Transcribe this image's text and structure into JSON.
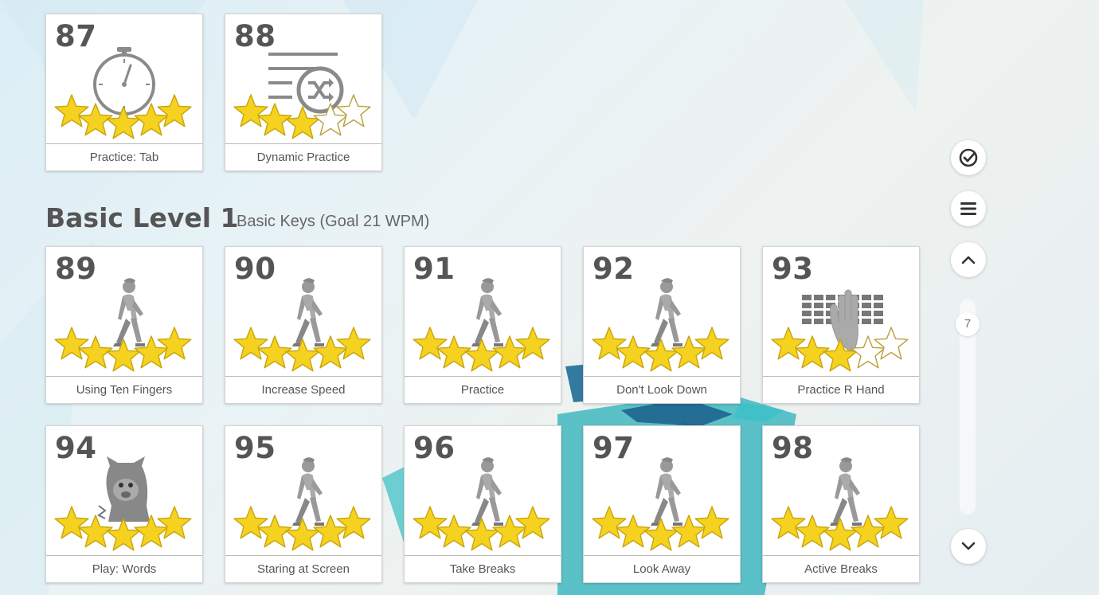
{
  "sections": [
    {
      "tiles": [
        {
          "number": "87",
          "label": "Practice: Tab",
          "icon": "stopwatch-icon",
          "stars": 5
        },
        {
          "number": "88",
          "label": "Dynamic Practice",
          "icon": "shuffle-list-icon",
          "stars": 3
        }
      ]
    },
    {
      "title": "Basic Level 1",
      "subtitle": "Basic Keys (Goal 21 WPM)",
      "tiles": [
        {
          "number": "89",
          "label": "Using Ten Fingers",
          "icon": "walking-person-icon",
          "stars": 5
        },
        {
          "number": "90",
          "label": "Increase Speed",
          "icon": "walking-person-icon",
          "stars": 5
        },
        {
          "number": "91",
          "label": "Practice",
          "icon": "walking-person-icon",
          "stars": 5
        },
        {
          "number": "92",
          "label": "Don't Look Down",
          "icon": "walking-person-icon",
          "stars": 5
        },
        {
          "number": "93",
          "label": "Practice R Hand",
          "icon": "keyboard-hand-icon",
          "stars": 3
        },
        {
          "number": "94",
          "label": "Play: Words",
          "icon": "monster-icon",
          "stars": 5
        },
        {
          "number": "95",
          "label": "Staring at Screen",
          "icon": "walking-person-icon",
          "stars": 5
        },
        {
          "number": "96",
          "label": "Take Breaks",
          "icon": "walking-person-icon",
          "stars": 5
        },
        {
          "number": "97",
          "label": "Look Away",
          "icon": "walking-person-icon",
          "stars": 5
        },
        {
          "number": "98",
          "label": "Active Breaks",
          "icon": "walking-person-icon",
          "stars": 5
        }
      ]
    }
  ],
  "sidebar": {
    "buttons": [
      "check-circle-icon",
      "menu-icon",
      "chevron-up-icon",
      "chevron-down-icon"
    ],
    "page_indicator": "7"
  },
  "colors": {
    "star_fill": "#f5d21f",
    "star_empty": "#ffffff",
    "icon_gray": "#8a8a8a"
  }
}
